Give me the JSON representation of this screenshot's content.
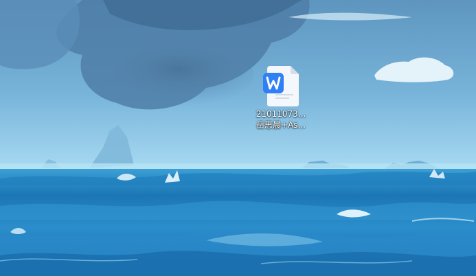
{
  "desktop": {
    "wallpaper_icon": "ocean-seascape",
    "icons": [
      {
        "type": "word-document-icon",
        "accent_color": "#2f7ff5",
        "label_line1": "21011073...",
        "label_line2": "岳思晨+As..."
      }
    ]
  }
}
